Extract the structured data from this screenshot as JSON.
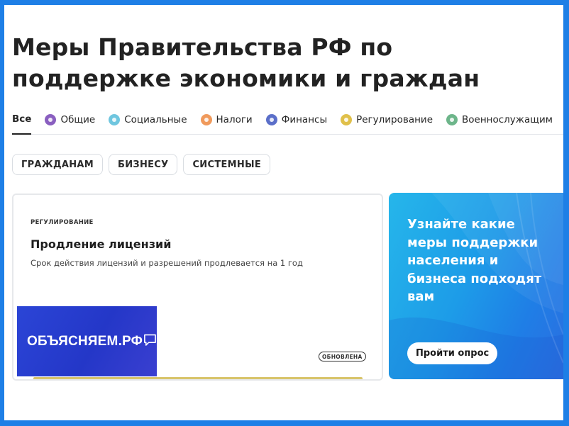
{
  "page": {
    "title": "Меры Правительства РФ по поддержке экономики и граждан"
  },
  "tabs": [
    {
      "label": "Все",
      "active": true,
      "icon": "",
      "color": ""
    },
    {
      "label": "Общие",
      "active": false,
      "icon": "grid-icon",
      "color": "#8a5fc0"
    },
    {
      "label": "Социальные",
      "active": false,
      "icon": "person-icon",
      "color": "#6fc6df"
    },
    {
      "label": "Налоги",
      "active": false,
      "icon": "percent-icon",
      "color": "#f09a5c"
    },
    {
      "label": "Финансы",
      "active": false,
      "icon": "wallet-icon",
      "color": "#5b6fc9"
    },
    {
      "label": "Регулирование",
      "active": false,
      "icon": "gear-icon",
      "color": "#e0c04a"
    },
    {
      "label": "Военнослужащим",
      "active": false,
      "icon": "shield-icon",
      "color": "#6db58a"
    }
  ],
  "filters": [
    "ГРАЖДАНАМ",
    "БИЗНЕСУ",
    "СИСТЕМНЫЕ"
  ],
  "card": {
    "category": "РЕГУЛИРОВАНИЕ",
    "title": "Продление лицензий",
    "text": "Срок действия лицензий и разрешений продлевается на 1 год",
    "logo_text": "ОБЪЯСНЯЕМ.РФ",
    "badge": "ОБНОВЛЕНА",
    "bar_color": "#d8c46a"
  },
  "promo": {
    "text": "Узнайте какие меры поддержки населения и бизнеса подходят вам",
    "button": "Пройти опрос"
  },
  "colors": {
    "frame_border": "#1e7fe6",
    "promo_gradient_start": "#26b6ea",
    "promo_gradient_end": "#2c6ee0",
    "logo_background": "#2437c8"
  }
}
